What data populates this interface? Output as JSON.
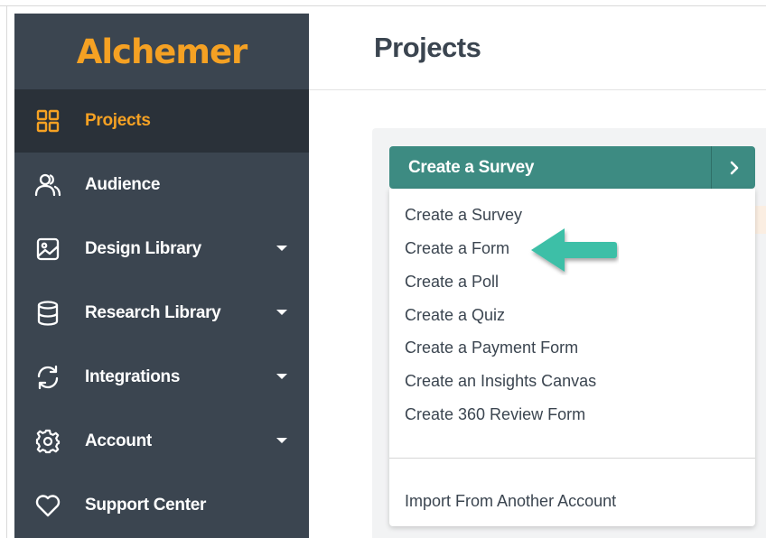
{
  "app": {
    "brand": "Alchemer",
    "brand_color": "#f5a123"
  },
  "sidebar": {
    "items": [
      {
        "label": "Projects",
        "icon": "grid-icon",
        "active": true,
        "has_caret": false
      },
      {
        "label": "Audience",
        "icon": "users-icon",
        "active": false,
        "has_caret": false
      },
      {
        "label": "Design Library",
        "icon": "image-icon",
        "active": false,
        "has_caret": true
      },
      {
        "label": "Research Library",
        "icon": "database-icon",
        "active": false,
        "has_caret": true
      },
      {
        "label": "Integrations",
        "icon": "refresh-icon",
        "active": false,
        "has_caret": true
      },
      {
        "label": "Account",
        "icon": "gear-icon",
        "active": false,
        "has_caret": true
      },
      {
        "label": "Support Center",
        "icon": "heart-icon",
        "active": false,
        "has_caret": false
      }
    ]
  },
  "header": {
    "title": "Projects"
  },
  "create_menu": {
    "button_label": "Create a Survey",
    "button_color": "#3d8b82",
    "arrow_icon": "chevron-right-icon",
    "items": [
      "Create a Survey",
      "Create a Form",
      "Create a Poll",
      "Create a Quiz",
      "Create a Payment Form",
      "Create an Insights Canvas",
      "Create 360 Review Form"
    ],
    "footer_item": "Import From Another Account"
  },
  "annotation": {
    "icon": "pointer-arrow-icon",
    "color": "#3dbfa7"
  }
}
